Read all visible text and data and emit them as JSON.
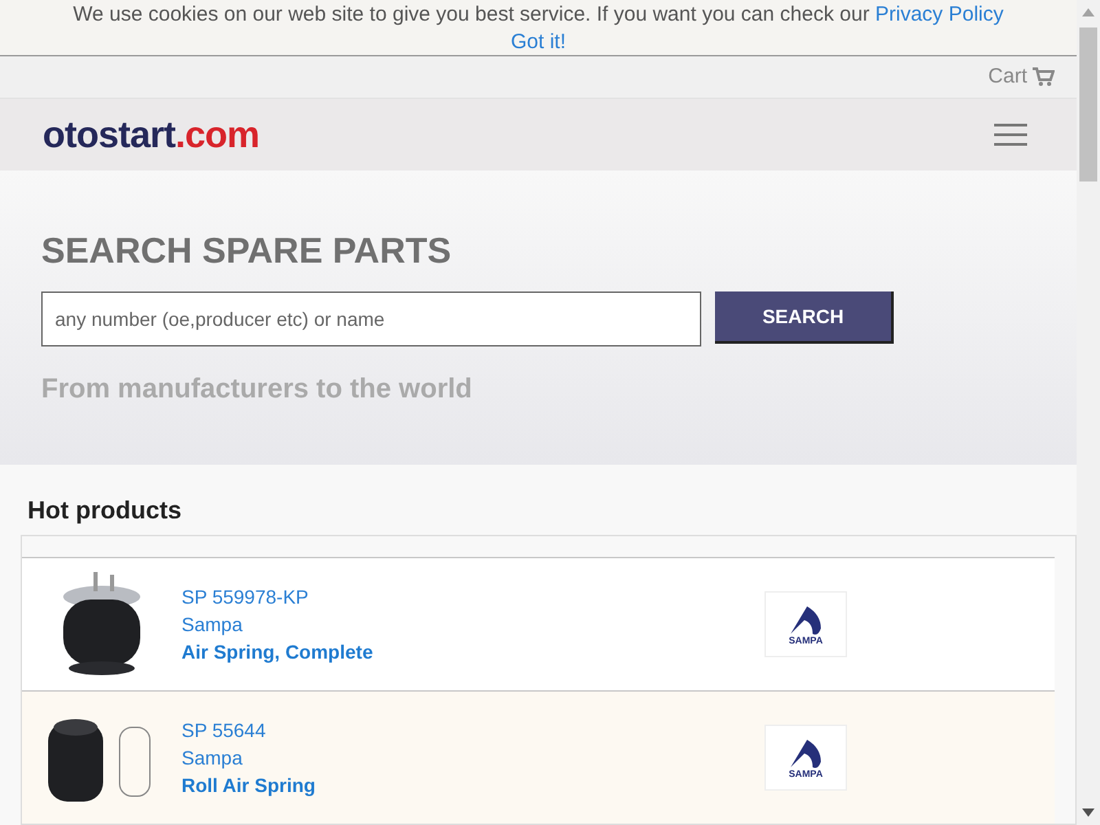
{
  "cookie_bar": {
    "message": "We use cookies on our web site to give you best service. If you want you can check our",
    "link": "Privacy Policy",
    "accept": "Got it!"
  },
  "top_bar": {
    "cart": "Cart"
  },
  "header": {
    "logo_main": "otostart",
    "logo_domain": ".com"
  },
  "hero": {
    "title": "SEARCH SPARE PARTS",
    "search_placeholder": "any number (oe,producer etc) or name",
    "search_button": "SEARCH",
    "tagline": "From manufacturers to the world"
  },
  "hot_products": {
    "title": "Hot products",
    "items": [
      {
        "code": "SP 559978-KP",
        "brand": "Sampa",
        "name": "Air Spring, Complete",
        "brand_logo": "SAMPA",
        "kind": "complete"
      },
      {
        "code": "SP 55644",
        "brand": "Sampa",
        "name": "Roll Air Spring",
        "brand_logo": "SAMPA",
        "kind": "roll"
      }
    ]
  }
}
